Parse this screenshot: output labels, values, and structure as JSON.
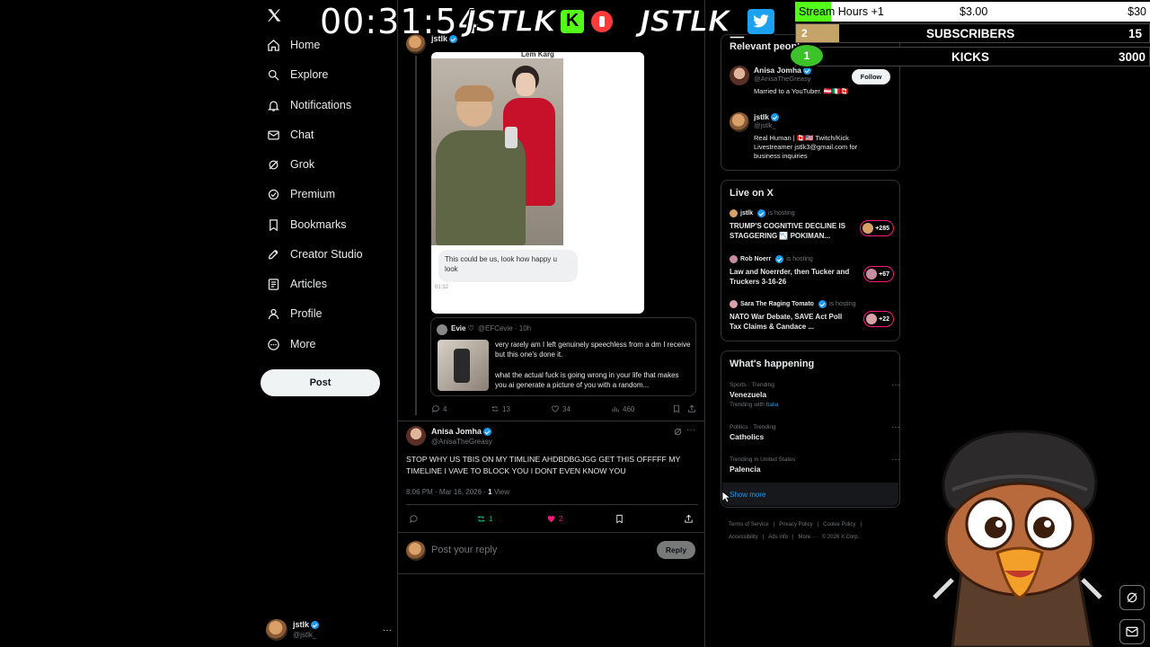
{
  "nav": {
    "items": [
      {
        "label": "Home",
        "icon": "home-icon"
      },
      {
        "label": "Explore",
        "icon": "search-icon"
      },
      {
        "label": "Notifications",
        "icon": "bell-icon"
      },
      {
        "label": "Chat",
        "icon": "mail-icon"
      },
      {
        "label": "Grok",
        "icon": "grok-icon"
      },
      {
        "label": "Premium",
        "icon": "premium-icon"
      },
      {
        "label": "Bookmarks",
        "icon": "bookmark-icon"
      },
      {
        "label": "Creator Studio",
        "icon": "rocket-icon"
      },
      {
        "label": "Articles",
        "icon": "article-icon"
      },
      {
        "label": "Profile",
        "icon": "person-icon"
      },
      {
        "label": "More",
        "icon": "more-icon"
      }
    ],
    "post_label": "Post",
    "me": {
      "name": "jstlk",
      "handle": "@jstlk_",
      "menu": "···"
    }
  },
  "tweet_top": {
    "name": "jstlk",
    "image_caption_top": "Lem Karg",
    "dm_text": "This could be us, look how happy u look",
    "dm_time": "01:32",
    "quote": {
      "name": "Evie ♡",
      "handle_time": "@EFCevie · 10h",
      "text1": "very rarely am I left genuinely speechless from a dm I receive but this one's done it.",
      "text2": "what the actual fuck is going wrong in your life that makes you ai generate a picture of you with a random..."
    },
    "stats": {
      "replies": "4",
      "reposts": "13",
      "likes": "34",
      "views": "460"
    }
  },
  "tweet_reply": {
    "name": "Anisa Jomha",
    "handle": "@AnisaTheGreasy",
    "text": "STOP WHY US TBIS ON MY TIMLINE AHDBDBGJGG GET THIS OFFFFF MY TIMELINE I VAVE TO BLOCK YOU I DONT EVEN KNOW YOU",
    "time": "8:06 PM · Mar 16, 2026 · ",
    "views_num": "1",
    "views_label": " View",
    "stats": {
      "reposts": "1",
      "likes": "2"
    }
  },
  "reply_box": {
    "placeholder": "Post your reply",
    "button": "Reply"
  },
  "relevant": {
    "title": "Relevant people",
    "people": [
      {
        "name": "Anisa Jomha",
        "handle": "@AnisaTheGreasy",
        "bio": "Married to a YouTuber. 🇦🇹🇮🇹🇨🇦",
        "follow": "Follow"
      },
      {
        "name": "jstlk",
        "handle": "@jstlk_",
        "bio": "Real Human | 🇨🇦🇺🇸 Twitch/Kick Livestreamer jstlk3@gmail.com for business inquiries"
      }
    ]
  },
  "live": {
    "title": "Live on X",
    "items": [
      {
        "host": "jstlk",
        "is_hosting": "is hosting",
        "title": "TRUMP'S COGNITIVE DECLINE IS STAGGERING 📉 POKIMAN...",
        "count": "+285"
      },
      {
        "host": "Rob Noerr",
        "is_hosting": "is hosting",
        "title": "Law and Noerrder, then Tucker and Truckers 3-16-26",
        "count": "+67"
      },
      {
        "host": "Sara The Raging Tomato",
        "is_hosting": "is hosting",
        "title": "NATO War Debate, SAVE Act Poll Tax Claims & Candace ...",
        "count": "+22"
      }
    ]
  },
  "happening": {
    "title": "What's happening",
    "trends": [
      {
        "category": "Sports · Trending",
        "name": "Venezuela",
        "extra_prefix": "Trending with ",
        "extra_link": "Italia"
      },
      {
        "category": "Politics · Trending",
        "name": "Catholics"
      },
      {
        "category": "Trending in United States",
        "name": "Palencia"
      }
    ],
    "show_more": "Show more"
  },
  "footer": {
    "line1": [
      "Terms of Service",
      "|",
      "Privacy Policy",
      "|",
      "Cookie Policy",
      "|"
    ],
    "line2": [
      "Accessibility",
      "|",
      "Ads info",
      "|",
      "More ···",
      "© 2026 X Corp."
    ]
  },
  "overlay": {
    "timer": "00:31:54",
    "brand1": "JSTLK",
    "brand2": "JSTLK_",
    "row1": {
      "label": "Stream Hours +1",
      "price": "$3.00",
      "total": "$30"
    },
    "row2": {
      "rank": "2",
      "label": "SUBSCRIBERS",
      "value": "15"
    },
    "row3": {
      "rank": "1",
      "label": "KICKS",
      "value": "3000"
    },
    "progress_fraction": 0.1
  },
  "colors": {
    "accent": "#1d9bf0",
    "like": "#f91880",
    "repost": "#00ba7c",
    "kick_green": "#53fc18",
    "twitter_blue": "#1da1f2"
  }
}
